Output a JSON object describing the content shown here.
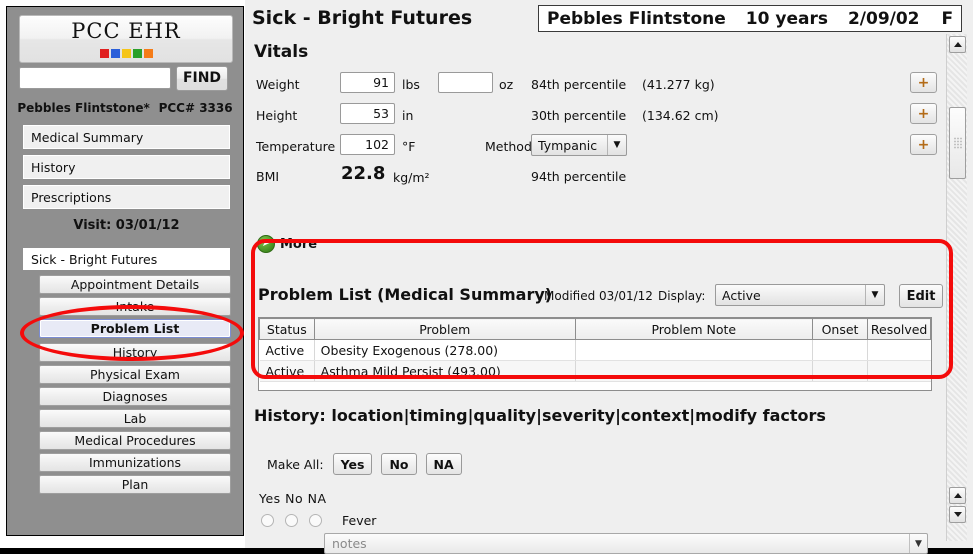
{
  "app": {
    "logo_text": "PCC EHR",
    "logo_colors": [
      "#e02020",
      "#2b5fd9",
      "#f5c518",
      "#2aa02a",
      "#f57c18"
    ],
    "accent_red": "#f40b0b"
  },
  "search": {
    "value": "",
    "placeholder": "",
    "find_label": "FIND"
  },
  "patient_sidebar": {
    "name": "Pebbles Flintstone*",
    "pcc_number": "PCC# 3336"
  },
  "sidebar": {
    "chart_items": [
      {
        "label": "Medical Summary"
      },
      {
        "label": "History"
      },
      {
        "label": "Prescriptions"
      }
    ],
    "visit_label": "Visit: 03/01/12",
    "visit_value": "Sick - Bright Futures",
    "nav_items": [
      {
        "label": "Appointment Details",
        "selected": false
      },
      {
        "label": "Intake",
        "selected": false
      },
      {
        "label": "Problem List",
        "selected": true
      },
      {
        "label": "History",
        "selected": false
      },
      {
        "label": "Physical Exam",
        "selected": false
      },
      {
        "label": "Diagnoses",
        "selected": false
      },
      {
        "label": "Lab",
        "selected": false
      },
      {
        "label": "Medical Procedures",
        "selected": false
      },
      {
        "label": "Immunizations",
        "selected": false
      },
      {
        "label": "Plan",
        "selected": false
      }
    ]
  },
  "header": {
    "visit_title": "Sick - Bright Futures",
    "patient_name": "Pebbles Flintstone",
    "patient_age": "10 years",
    "patient_dob": "2/09/02",
    "patient_sex": "F"
  },
  "vitals": {
    "title": "Vitals",
    "weight": {
      "label": "Weight",
      "lbs_value": "91",
      "lbs_unit": "lbs",
      "oz_value": "",
      "oz_unit": "oz",
      "percentile": "84th percentile",
      "metric": "(41.277 kg)"
    },
    "height": {
      "label": "Height",
      "value": "53",
      "unit": "in",
      "percentile": "30th percentile",
      "metric": "(134.62 cm)"
    },
    "temperature": {
      "label": "Temperature",
      "value": "102",
      "unit": "°F",
      "method_label": "Method",
      "method_value": "Tympanic"
    },
    "bmi": {
      "label": "BMI",
      "value": "22.8",
      "unit": "kg/m²",
      "percentile": "94th percentile"
    },
    "more_label": "More",
    "plus_label": "+"
  },
  "problem_list": {
    "title": "Problem List (Medical Summary)",
    "modified": "Modified 03/01/12",
    "display_label": "Display:",
    "display_value": "Active",
    "edit_label": "Edit",
    "columns": [
      "Status",
      "Problem",
      "Problem Note",
      "Onset",
      "Resolved"
    ],
    "rows": [
      {
        "status": "Active",
        "problem": "Obesity Exogenous (278.00)",
        "note": "",
        "onset": "",
        "resolved": ""
      },
      {
        "status": "Active",
        "problem": "Asthma Mild Persist (493.00)",
        "note": "",
        "onset": "",
        "resolved": ""
      }
    ]
  },
  "history": {
    "title": "History: location|timing|quality|severity|context|modify factors",
    "make_all_label": "Make All:",
    "make_all_buttons": [
      "Yes",
      "No",
      "NA"
    ],
    "column_legend": "Yes  No  NA",
    "items": [
      {
        "label": "Fever",
        "notes_placeholder": "notes"
      }
    ]
  }
}
